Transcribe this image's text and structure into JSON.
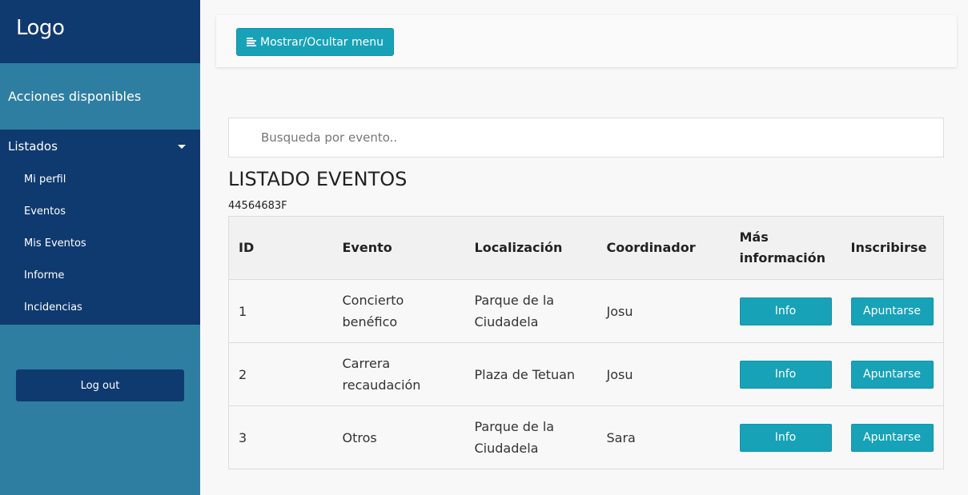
{
  "sidebar": {
    "logo": "Logo",
    "actions_title": "Acciones disponibles",
    "menu_title": "Listados",
    "items": [
      {
        "label": "Mi perfil"
      },
      {
        "label": "Eventos"
      },
      {
        "label": "Mis Eventos"
      },
      {
        "label": "Informe"
      },
      {
        "label": "Incidencias"
      }
    ],
    "logout_label": "Log out"
  },
  "topbar": {
    "toggle_label": "Mostrar/Ocultar menu"
  },
  "search": {
    "placeholder": "Busqueda por evento.."
  },
  "main": {
    "title": "LISTADO EVENTOS",
    "code": "44564683F",
    "table": {
      "headers": [
        "ID",
        "Evento",
        "Localización",
        "Coordinador",
        "Más información",
        "Inscribirse"
      ],
      "rows": [
        {
          "id": "1",
          "evento": "Concierto benéfico",
          "localizacion": "Parque de la Ciudadela",
          "coordinador": "Josu",
          "info": "Info",
          "join": "Apuntarse"
        },
        {
          "id": "2",
          "evento": "Carrera recaudación",
          "localizacion": "Plaza de Tetuan",
          "coordinador": "Josu",
          "info": "Info",
          "join": "Apuntarse"
        },
        {
          "id": "3",
          "evento": "Otros",
          "localizacion": "Parque de la Ciudadela",
          "coordinador": "Sara",
          "info": "Info",
          "join": "Apuntarse"
        }
      ]
    }
  },
  "colors": {
    "sidebar_dark": "#0f3a6f",
    "sidebar_light": "#2e7ea1",
    "accent": "#17a2b8"
  }
}
